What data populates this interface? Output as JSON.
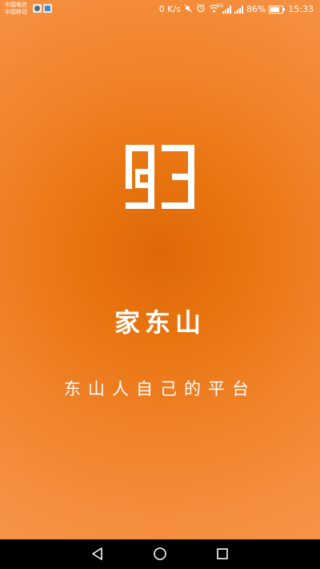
{
  "status_bar": {
    "carrier_line_1": "中国电信",
    "carrier_line_2": "中国移动",
    "net_speed": "0 K/s",
    "network_label": "2G",
    "battery_percent": "86%",
    "time": "15:33"
  },
  "splash": {
    "app_name": "家东山",
    "tagline": "东山人自己的平台"
  },
  "icons": {
    "logo": "logo-icon",
    "alarm": "alarm-icon",
    "wifi": "wifi-icon",
    "signal": "signal-icon",
    "battery": "battery-icon",
    "nav_back": "back-triangle-icon",
    "nav_home": "home-circle-icon",
    "nav_recent": "recent-square-icon"
  },
  "colors": {
    "background_center": "#de6808",
    "background_edge": "#f69347",
    "foreground": "#ffffff",
    "nav_bar": "#000000"
  }
}
